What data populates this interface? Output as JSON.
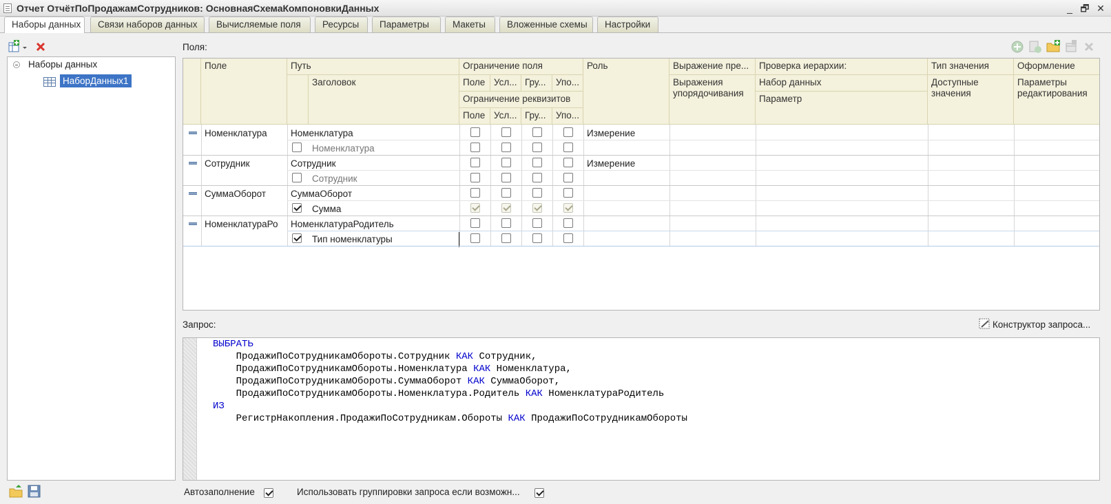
{
  "window": {
    "title": "Отчет ОтчётПоПродажамСотрудников: ОсновнаяСхемаКомпоновкиДанных",
    "buttons": {
      "minimize": "_",
      "restore": "🗗",
      "close": "✕"
    }
  },
  "tabs": [
    {
      "label": "Наборы данных",
      "active": true
    },
    {
      "label": "Связи наборов данных"
    },
    {
      "label": "Вычисляемые поля"
    },
    {
      "label": "Ресурсы"
    },
    {
      "label": "Параметры"
    },
    {
      "label": "Макеты"
    },
    {
      "label": "Вложенные схемы"
    },
    {
      "label": "Настройки"
    }
  ],
  "tree": {
    "root": "Наборы данных",
    "child": "НаборДанных1"
  },
  "fields_label": "Поля:",
  "grid": {
    "headers": {
      "field": "Поле",
      "path": "Путь",
      "title": "Заголовок",
      "restriction_field": "Ограничение поля",
      "r_field": "Поле",
      "r_cond": "Усл...",
      "r_group": "Гру...",
      "r_order": "Упо...",
      "restriction_attrs": "Ограничение реквизитов",
      "ra_field": "Поле",
      "ra_cond": "Усл...",
      "ra_group": "Гру...",
      "ra_order": "Упо...",
      "role": "Роль",
      "expr_pres": "Выражение пре...",
      "expr_order": "Выражения упорядочивания",
      "hier_check": "Проверка иерархии:",
      "dataset": "Набор данных",
      "param": "Параметр",
      "value_type": "Тип значения",
      "available_values": "Доступные значения",
      "format": "Оформление",
      "edit_params": "Параметры редактирования"
    },
    "rows": [
      {
        "field": "Номенклатура",
        "path": "Номенклатура",
        "title": "Номенклатура",
        "title_checked": false,
        "title_dim": true,
        "role": "Измерение",
        "restr_checked": false
      },
      {
        "field": "Сотрудник",
        "path": "Сотрудник",
        "title": "Сотрудник",
        "title_checked": false,
        "title_dim": true,
        "role": "Измерение",
        "restr_checked": false
      },
      {
        "field": "СуммаОборот",
        "path": "СуммаОборот",
        "title": "Сумма",
        "title_checked": true,
        "title_dim": false,
        "role": "",
        "restr_checked": true
      },
      {
        "field": "НоменклатураРо",
        "path": "НоменклатураРодитель",
        "title": "Тип номенклатуры",
        "title_checked": true,
        "title_dim": false,
        "role": "",
        "restr_checked": false
      }
    ]
  },
  "query": {
    "label": "Запрос:",
    "constructor_label": "Конструктор запроса...",
    "lines": [
      [
        {
          "t": "ВЫБРАТЬ",
          "kw": true
        }
      ],
      [
        {
          "t": "    ПродажиПоСотрудникамОбороты.Сотрудник "
        },
        {
          "t": "КАК",
          "kw": true
        },
        {
          "t": " Сотрудник,"
        }
      ],
      [
        {
          "t": "    ПродажиПоСотрудникамОбороты.Номенклатура "
        },
        {
          "t": "КАК",
          "kw": true
        },
        {
          "t": " Номенклатура,"
        }
      ],
      [
        {
          "t": "    ПродажиПоСотрудникамОбороты.СуммаОборот "
        },
        {
          "t": "КАК",
          "kw": true
        },
        {
          "t": " СуммаОборот,"
        }
      ],
      [
        {
          "t": "    ПродажиПоСотрудникамОбороты.Номенклатура.Родитель "
        },
        {
          "t": "КАК",
          "kw": true
        },
        {
          "t": " НоменклатураРодитель"
        }
      ],
      [
        {
          "t": "ИЗ",
          "kw": true
        }
      ],
      [
        {
          "t": "    РегистрНакопления.ПродажиПоСотрудникам.Обороты "
        },
        {
          "t": "КАК",
          "kw": true
        },
        {
          "t": " ПродажиПоСотрудникамОбороты"
        }
      ]
    ]
  },
  "bottom": {
    "autofill_label": "Автозаполнение",
    "autofill_checked": true,
    "use_grouping_label": "Использовать группировки запроса если возможн...",
    "use_grouping_checked": true
  },
  "icons": {
    "add": "add-dataset-icon",
    "delete": "delete-icon",
    "toolbar_right": [
      "add-circle-icon",
      "add-field-icon",
      "add-folder-icon",
      "add-table-icon",
      "remove-icon"
    ],
    "bottom_left": [
      "folder-icon",
      "save-icon"
    ]
  }
}
